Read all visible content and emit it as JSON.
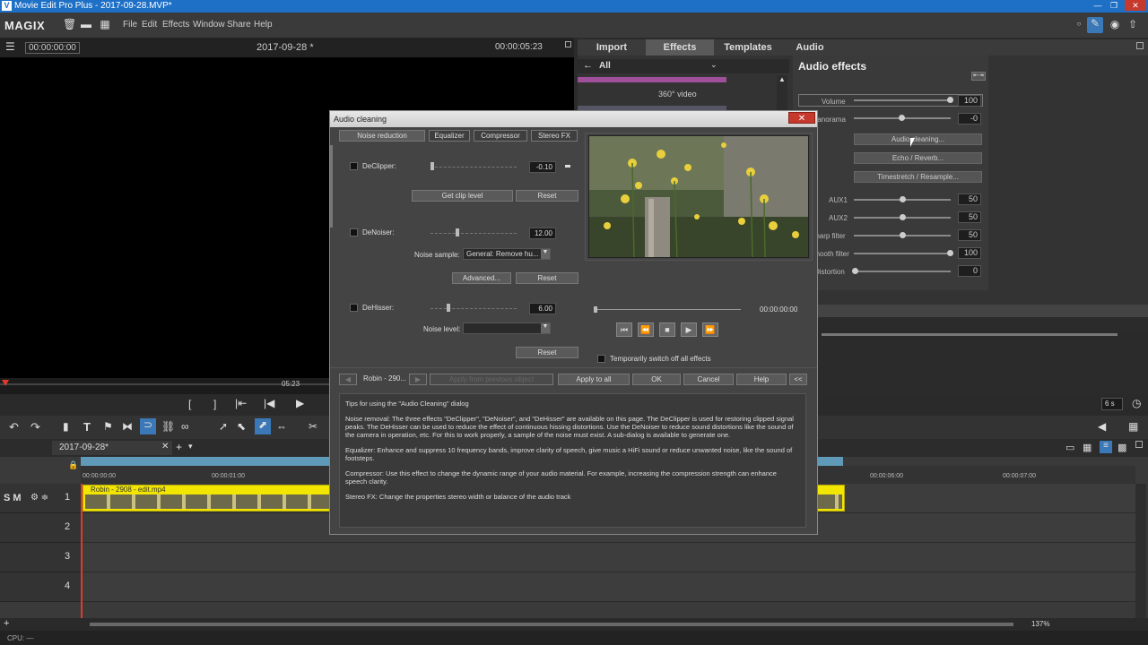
{
  "window": {
    "title": "Movie Edit Pro Plus - 2017-09-28.MVP*"
  },
  "menubar": {
    "brand": "MAGIX",
    "items": [
      "File",
      "Edit",
      "Effects",
      "Window",
      "Share",
      "Help"
    ]
  },
  "preview": {
    "timecode_left": "00:00:00:00",
    "project": "2017-09-28 *",
    "timecode_right": "00:00:05:23",
    "marker": "05:23"
  },
  "right_tabs": [
    "Import",
    "Effects",
    "Templates",
    "Audio"
  ],
  "browser": {
    "category": "All",
    "item": "360° video"
  },
  "audio_effects": {
    "title": "Audio effects",
    "volume_label": "Volume",
    "volume_value": "100",
    "volume_level": 1.0,
    "panorama_label": "Panorama",
    "panorama_value": "-0",
    "panorama_level": 0.5,
    "btn_cleaning": "Audio cleaning...",
    "btn_echo": "Echo / Reverb...",
    "btn_timestretch": "Timestretch / Resample...",
    "aux1_label": "AUX1",
    "aux1_value": "50",
    "aux2_label": "AUX2",
    "aux2_value": "50",
    "sharp_label": "Sharp filter",
    "sharp_value": "50",
    "smooth_label": "Smooth filter",
    "smooth_value": "100",
    "distortion_label": "Distortion",
    "distortion_value": "0"
  },
  "transport": {
    "zoom": "6 s"
  },
  "timeline": {
    "tab": "2017-09-28*",
    "ruler": [
      "00:00:00:00",
      "00:00:01:00",
      "00:00:06:00",
      "00:00:07:00"
    ],
    "clip_name": "Robin - 2908 - edit.mp4",
    "tracks": [
      "1",
      "2",
      "3",
      "4"
    ],
    "track_controls": "S M",
    "zoom_pct": "137%"
  },
  "status": {
    "cpu": "CPU: —"
  },
  "dialog": {
    "title": "Audio cleaning",
    "close": "✕",
    "tabs": [
      "Noise reduction",
      "Equalizer",
      "Compressor",
      "Stereo FX"
    ],
    "declipper_label": "DeClipper:",
    "declipper_value": "-0.10",
    "get_clip_level": "Get clip level",
    "reset": "Reset",
    "denoiser_label": "DeNoiser:",
    "denoiser_value": "12.00",
    "noise_sample_label": "Noise sample:",
    "noise_sample_value": "General: Remove  hu...",
    "advanced": "Advanced...",
    "dehisser_label": "DeHisser:",
    "dehisser_value": "6.00",
    "noise_level_label": "Noise level:",
    "pos_time": "00:00:00:00",
    "switch_off_label": "Temporarily switch off all effects",
    "object_name": "Robin - 290...",
    "apply_prev": "Apply from previous object",
    "apply_all": "Apply to all",
    "ok": "OK",
    "cancel": "Cancel",
    "help": "Help",
    "collapse": "<<",
    "tips_title": "Tips for using the \"Audio Cleaning\" dialog",
    "tips": [
      "Noise removal: The three effects \"DeClipper\", \"DeNoiser\", and \"DeHisser\" are available on this page. The DeClipper is used for restoring clipped signal peaks. The DeHisser can be used to reduce the effect of continuous hissing distortions. Use the DeNoiser to reduce sound distortions like the sound of the camera in operation, etc. For this to work properly, a sample of the noise must exist. A sub-dialog is available to generate one.",
      "Equalizer: Enhance and suppress 10 frequency bands, improve clarity of speech, give music a HiFi sound or reduce unwanted noise, like the sound of footsteps.",
      "Compressor: Use this effect to change the dynamic range of your audio material. For example, increasing the compression strength can enhance speech clarity.",
      "Stereo FX: Change the properties stereo width or balance of the audio track"
    ]
  }
}
